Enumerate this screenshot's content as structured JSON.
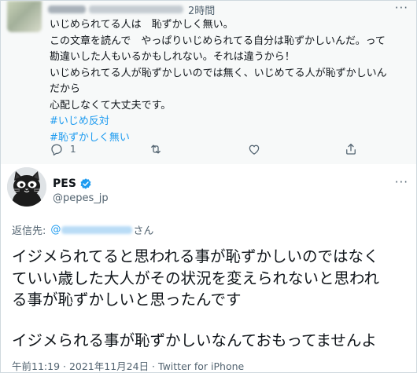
{
  "parent_tweet": {
    "time": "2時間",
    "lines": [
      "いじめられてる人は　恥ずかしく無い。",
      "この文章を読んで　やっぱりいじめられてる自分は恥ずかしいんだ。って",
      "勘違いした人もいるかもしれない。それは違うから！",
      "いじめられてる人が恥ずかしいのでは無く、いじめてる人が恥ずかしいん",
      "だから",
      "心配しなくて大丈夫です。"
    ],
    "hashtags": [
      "#いじめ反対",
      "#恥ずかしく無い"
    ],
    "reply_count": "1",
    "icons": [
      "reply-icon",
      "retweet-icon",
      "like-icon",
      "share-icon"
    ]
  },
  "main_tweet": {
    "author_name": "PES",
    "author_handle": "@pepes_jp",
    "reply_prefix": "返信先:",
    "reply_at": "@",
    "reply_suffix": "さん",
    "lines": [
      "イジメられてると思われる事が恥ずかしいのではなく",
      "ていい歳した大人がその状況を変えられないと思われ",
      "る事が恥ずかしいと思ったんです",
      "",
      "イジメられる事が恥ずかしいなんておもってませんよ"
    ],
    "timestamp": "午前11:19 · 2021年11月24日 ·",
    "source": "Twitter for iPhone"
  },
  "colors": {
    "link": "#1d9bf0",
    "secondary_text": "#536471",
    "parent_bg": "#f7f9f9"
  }
}
